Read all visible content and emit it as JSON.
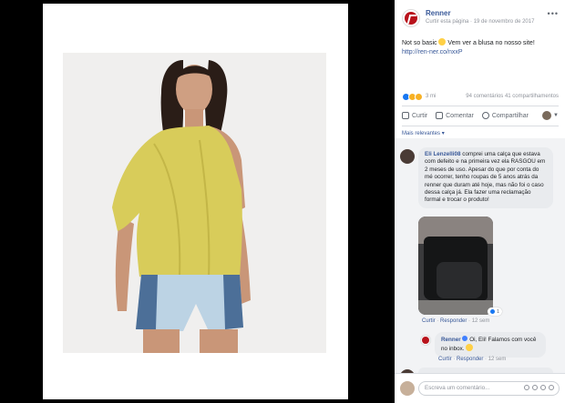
{
  "post": {
    "page_name": "Renner",
    "like_page": "Curtir esta página",
    "date": "19 de novembro de 2017",
    "text": "Not so basic",
    "text_after_emoji": " Vem ver a blusa no nosso site!",
    "link": "http://ren-ner.co/nxxP"
  },
  "reactions": {
    "count": "3 mi",
    "stats": "94 comentários  41 compartilhamentos"
  },
  "actions": {
    "like": "Curtir",
    "comment": "Comentar",
    "share": "Compartilhar"
  },
  "sort_label": "Mais relevantes",
  "comments": [
    {
      "author": "Eli Lenzelli08",
      "text": " comprei uma calça que estava com defeito e na primeira vez ela RASGOU em 2 meses de uso. Apesar do que por conta do mé ocorrer, tenho roupas de 5 anos atrás da renner que duram até hoje, mas não foi o caso dessa calça já. Ela fazer uma reclamação formal e trocar o produto!",
      "links_like": "Curtir",
      "links_reply": "Responder",
      "time": "12 sem",
      "likes": "1"
    },
    {
      "author": "Renner",
      "text": " Oi, Eli! Falamos com você no inbox.",
      "links_like": "Curtir",
      "links_reply": "Responder",
      "time": "12 sem"
    }
  ],
  "composer": {
    "placeholder": "Escreva um comentário..."
  },
  "colors": {
    "brand": "#b8121b",
    "link": "#385898",
    "top_color": "#d8cc5a",
    "shorts_light": "#bcd3e4",
    "shorts_dark": "#4c6f98"
  }
}
